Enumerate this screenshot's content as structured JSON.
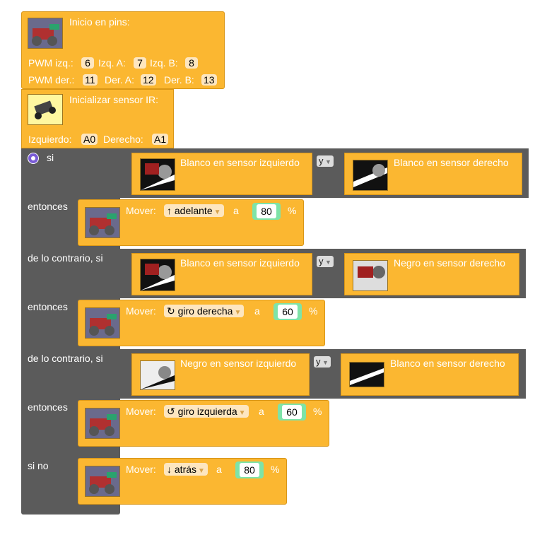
{
  "init": {
    "title": "Inicio en pins:",
    "pwm_left_label": "PWM izq.:",
    "pwm_left": "6",
    "izq_a_label": "Izq. A:",
    "izq_a": "7",
    "izq_b_label": "Izq. B:",
    "izq_b": "8",
    "pwm_right_label": "PWM der.:",
    "pwm_right": "11",
    "der_a_label": "Der. A:",
    "der_a": "12",
    "der_b_label": "Der. B:",
    "der_b": "13"
  },
  "ir": {
    "title": "Inicializar sensor IR:",
    "left_label": "Izquierdo:",
    "left": "A0",
    "right_label": "Derecho:",
    "right": "A1"
  },
  "ifblock": {
    "if_label": "si",
    "then_label": "entonces",
    "elseif_label": "de lo contrario, si",
    "else_label": "si no",
    "and_label": "y"
  },
  "conditions": [
    {
      "left": "Blanco en sensor izquierdo",
      "right": "Blanco en sensor derecho"
    },
    {
      "left": "Blanco en sensor izquierdo",
      "right": "Negro en sensor derecho"
    },
    {
      "left": "Negro en sensor izquierdo",
      "right": "Blanco en sensor derecho"
    }
  ],
  "moves": [
    {
      "label": "Mover:",
      "direction": "↑ adelante",
      "a": "a",
      "value": "80",
      "unit": "%"
    },
    {
      "label": "Mover:",
      "direction": "↻ giro derecha",
      "a": "a",
      "value": "60",
      "unit": "%"
    },
    {
      "label": "Mover:",
      "direction": "↺ giro izquierda",
      "a": "a",
      "value": "60",
      "unit": "%"
    },
    {
      "label": "Mover:",
      "direction": "↓ atrás",
      "a": "a",
      "value": "80",
      "unit": "%"
    }
  ],
  "colors": {
    "block": "#fbb731",
    "control": "#5b5b5b",
    "number": "#7ee3a8"
  },
  "icons": {
    "robot": "robot-car-icon",
    "sensor": "ir-sensor-icon",
    "gear": "gear-icon"
  }
}
